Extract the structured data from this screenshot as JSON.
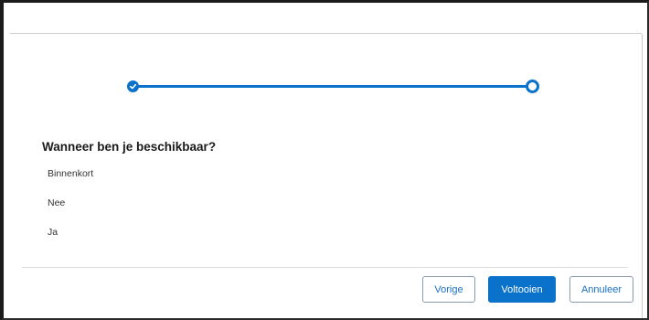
{
  "progress": {
    "steps": [
      {
        "state": "completed",
        "icon": "check-icon"
      },
      {
        "state": "current",
        "icon": "ring-icon"
      }
    ],
    "accent_color": "#0b72cc"
  },
  "question": {
    "title": "Wanneer ben je beschikbaar?",
    "options": [
      "Binnenkort",
      "Nee",
      "Ja"
    ]
  },
  "footer": {
    "previous_label": "Vorige",
    "finish_label": "Voltooien",
    "cancel_label": "Annuleer"
  }
}
